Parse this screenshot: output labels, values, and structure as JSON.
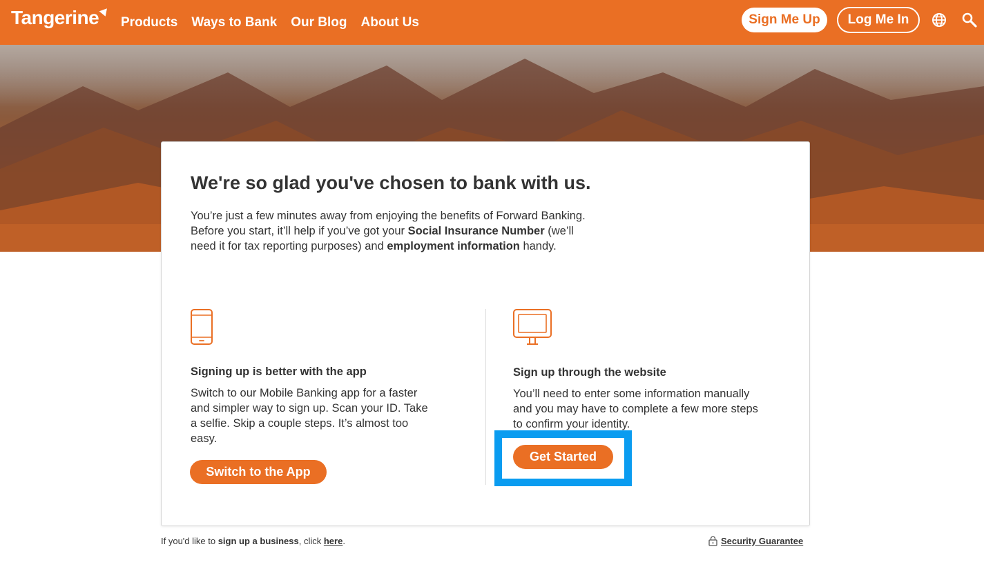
{
  "header": {
    "logo_text": "Tangerine",
    "nav": [
      "Products",
      "Ways to Bank",
      "Our Blog",
      "About Us"
    ],
    "sign_up_label": "Sign Me Up",
    "log_in_label": "Log Me In",
    "language_icon": "globe-icon",
    "search_icon": "search-icon"
  },
  "card": {
    "title": "We're so glad you've chosen to bank with us.",
    "intro_1": "You’re just a few minutes away from enjoying the benefits of Forward Banking. Before you start, it’ll help if you’ve got your ",
    "intro_sin": "Social Insurance Number",
    "intro_2": " (we’ll need it for tax reporting purposes) and ",
    "intro_emp": "employment information",
    "intro_3": " handy.",
    "app": {
      "icon": "phone-icon",
      "heading": "Signing up is better with the app",
      "body": "Switch to our Mobile Banking app for a faster and simpler way to sign up. Scan your ID. Take a selfie. Skip a couple steps. It’s almost too easy.",
      "button": "Switch to the App"
    },
    "web": {
      "icon": "monitor-icon",
      "heading": "Sign up through the website",
      "body": "You’ll need to enter some information manually and you may have to complete a few more steps to confirm your identity.",
      "button": "Get Started"
    }
  },
  "footer": {
    "business_prefix": "If you'd like to ",
    "business_bold": "sign up a business",
    "business_mid": ", click ",
    "business_link": "here",
    "business_suffix": ".",
    "security_icon": "lock-icon",
    "security_link": "Security Guarantee"
  },
  "colors": {
    "brand_orange": "#ea6f24",
    "highlight_blue": "#0a9cf0"
  }
}
